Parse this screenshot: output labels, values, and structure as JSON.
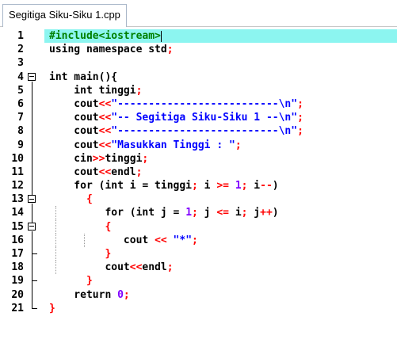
{
  "tab": {
    "title": "Segitiga Siku-Siku 1.cpp"
  },
  "lines": [
    {
      "n": "1",
      "tokens": [
        {
          "t": "#include<iostream>",
          "c": "pre"
        }
      ]
    },
    {
      "n": "2",
      "tokens": [
        {
          "t": "using namespace std",
          "c": "kw"
        },
        {
          "t": ";",
          "c": "op"
        }
      ]
    },
    {
      "n": "3",
      "tokens": []
    },
    {
      "n": "4",
      "tokens": [
        {
          "t": "int main(){",
          "c": "kw"
        }
      ]
    },
    {
      "n": "5",
      "tokens": [
        {
          "t": "    int tinggi",
          "c": "kw"
        },
        {
          "t": ";",
          "c": "op"
        }
      ]
    },
    {
      "n": "6",
      "tokens": [
        {
          "t": "    cout",
          "c": "kw"
        },
        {
          "t": "<<",
          "c": "op"
        },
        {
          "t": "\"--------------------------\\n\"",
          "c": "str"
        },
        {
          "t": ";",
          "c": "op"
        }
      ]
    },
    {
      "n": "7",
      "tokens": [
        {
          "t": "    cout",
          "c": "kw"
        },
        {
          "t": "<<",
          "c": "op"
        },
        {
          "t": "\"-- Segitiga Siku-Siku 1 --\\n\"",
          "c": "str"
        },
        {
          "t": ";",
          "c": "op"
        }
      ]
    },
    {
      "n": "8",
      "tokens": [
        {
          "t": "    cout",
          "c": "kw"
        },
        {
          "t": "<<",
          "c": "op"
        },
        {
          "t": "\"--------------------------\\n\"",
          "c": "str"
        },
        {
          "t": ";",
          "c": "op"
        }
      ]
    },
    {
      "n": "9",
      "tokens": [
        {
          "t": "    cout",
          "c": "kw"
        },
        {
          "t": "<<",
          "c": "op"
        },
        {
          "t": "\"Masukkan Tinggi : \"",
          "c": "str"
        },
        {
          "t": ";",
          "c": "op"
        }
      ]
    },
    {
      "n": "10",
      "tokens": [
        {
          "t": "    cin",
          "c": "kw"
        },
        {
          "t": ">>",
          "c": "op"
        },
        {
          "t": "tinggi",
          "c": "kw"
        },
        {
          "t": ";",
          "c": "op"
        }
      ]
    },
    {
      "n": "11",
      "tokens": [
        {
          "t": "    cout",
          "c": "kw"
        },
        {
          "t": "<<",
          "c": "op"
        },
        {
          "t": "endl",
          "c": "kw"
        },
        {
          "t": ";",
          "c": "op"
        }
      ]
    },
    {
      "n": "12",
      "tokens": [
        {
          "t": "    for (int i = tinggi",
          "c": "kw"
        },
        {
          "t": "; ",
          "c": "op"
        },
        {
          "t": "i ",
          "c": "kw"
        },
        {
          "t": ">= ",
          "c": "op"
        },
        {
          "t": "1",
          "c": "num"
        },
        {
          "t": "; ",
          "c": "op"
        },
        {
          "t": "i",
          "c": "kw"
        },
        {
          "t": "--",
          "c": "op"
        },
        {
          "t": ")",
          "c": "kw"
        }
      ]
    },
    {
      "n": "13",
      "tokens": [
        {
          "t": "      {",
          "c": "op"
        }
      ]
    },
    {
      "n": "14",
      "tokens": [
        {
          "t": "         for (int j = ",
          "c": "kw"
        },
        {
          "t": "1",
          "c": "num"
        },
        {
          "t": "; ",
          "c": "op"
        },
        {
          "t": "j ",
          "c": "kw"
        },
        {
          "t": "<= ",
          "c": "op"
        },
        {
          "t": "i",
          "c": "kw"
        },
        {
          "t": "; ",
          "c": "op"
        },
        {
          "t": "j",
          "c": "kw"
        },
        {
          "t": "++",
          "c": "op"
        },
        {
          "t": ")",
          "c": "kw"
        }
      ]
    },
    {
      "n": "15",
      "tokens": [
        {
          "t": "         {",
          "c": "op"
        }
      ]
    },
    {
      "n": "16",
      "tokens": [
        {
          "t": "            cout ",
          "c": "kw"
        },
        {
          "t": "<< ",
          "c": "op"
        },
        {
          "t": "\"*\"",
          "c": "str"
        },
        {
          "t": ";",
          "c": "op"
        }
      ]
    },
    {
      "n": "17",
      "tokens": [
        {
          "t": "         }",
          "c": "op"
        }
      ]
    },
    {
      "n": "18",
      "tokens": [
        {
          "t": "         cout",
          "c": "kw"
        },
        {
          "t": "<<",
          "c": "op"
        },
        {
          "t": "endl",
          "c": "kw"
        },
        {
          "t": ";",
          "c": "op"
        }
      ]
    },
    {
      "n": "19",
      "tokens": [
        {
          "t": "      }",
          "c": "op"
        }
      ]
    },
    {
      "n": "20",
      "tokens": [
        {
          "t": "    return ",
          "c": "kw"
        },
        {
          "t": "0",
          "c": "num"
        },
        {
          "t": ";",
          "c": "op"
        }
      ]
    },
    {
      "n": "21",
      "tokens": [
        {
          "t": "}",
          "c": "op"
        }
      ]
    }
  ],
  "colors": {
    "preprocessor": "#008000",
    "keyword": "#000000",
    "string": "#0000ff",
    "number": "#8000ff",
    "operator": "#ff0000",
    "current_line": "#8cf5f0"
  }
}
